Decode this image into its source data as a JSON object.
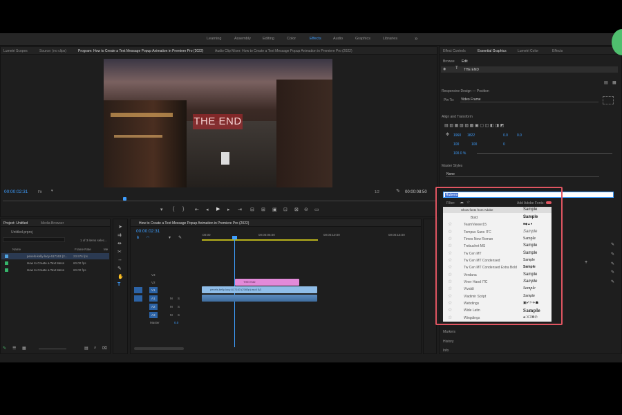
{
  "workspaces": {
    "tabs": [
      "Learning",
      "Assembly",
      "Editing",
      "Color",
      "Effects",
      "Audio",
      "Graphics",
      "Libraries"
    ],
    "active": "Effects",
    "more": "»"
  },
  "top_left_panel": {
    "tabs": [
      "Lumetri Scopes",
      "Source: (no clips)",
      "Program: How to Create a Text Message Popup Animation in Premiere Pro (2022)",
      "Audio Clip Mixer: How to Create a Text Message Popup Animation in Premiere Pro (2022)"
    ],
    "active_index": 2
  },
  "program": {
    "overlay_text": "THE END",
    "timecode_left": "00:00:02:31",
    "fit": "Fit",
    "fraction": "1/2",
    "timecode_right": "00:00:08:50"
  },
  "project": {
    "tabs": [
      "Project: Untitled",
      "Media Browser"
    ],
    "file": "Untitled.prproj",
    "selection": "1 of 3 items selec...",
    "columns": [
      "Name",
      "Frame Rate",
      "Me"
    ],
    "items": [
      {
        "name": "pexels-kelly-lacy-617163 (2...",
        "fps": "23.976 fps",
        "color": "#4fa3e0"
      },
      {
        "name": "How to Create a Text Mess",
        "fps": "60.00 fps",
        "color": "#36b46b"
      },
      {
        "name": "How to Create a Text Mess",
        "fps": "60.00 fps",
        "color": "#36b46b"
      }
    ]
  },
  "timeline": {
    "title": "How to Create a Text Message Popup Animation in Premiere Pro (2022)",
    "timecode": "00:00:02:31",
    "ruler": [
      ":00:00",
      "00:00:05:00",
      "00:00:10:00",
      "00:00:15:00"
    ],
    "tracks_v": [
      "V3",
      "V2",
      "V1"
    ],
    "tracks_a": [
      "A1",
      "A2",
      "A3"
    ],
    "master_label": "Master",
    "master_value": "0.0",
    "clip_text": "THE END",
    "clip_video": "pexels-kelly-lacy-617163 (2160p).mp4 [V]",
    "track_m": "M",
    "track_s": "S"
  },
  "right_panel": {
    "tabs": [
      "Effect Controls",
      "Essential Graphics",
      "Lumetri Color",
      "Effects"
    ],
    "active_index": 1,
    "subtabs": [
      "Browse",
      "Edit"
    ],
    "layer": "THE END",
    "responsive": "Responsive Design — Position",
    "pin_label": "Pin To:",
    "pin_value": "Video Frame",
    "align": "Align and Transform",
    "pos_x": "1960",
    "pos_y": "1822",
    "rot_a": "0.0",
    "rot_b": "0.0",
    "scale": "100",
    "scale2": "100",
    "anchor": "0",
    "opacity": "100.0 %",
    "master_styles": "Master Styles",
    "styles_value": "None",
    "font_search": "Rubens",
    "filter": "Filter:",
    "add_fonts": "Add Adobe Fonts:",
    "show_fonts": "Show fonts from Adobe",
    "header_sample": "Sample",
    "bottom_items": [
      "Markers",
      "History",
      "Info"
    ],
    "fonts": [
      {
        "name": "Bold",
        "sample": "Sample"
      },
      {
        "name": "TeamViewer15",
        "sample": "■◆▲●"
      },
      {
        "name": "Tempus Sans ITC",
        "sample": "Sample"
      },
      {
        "name": "Times New Roman",
        "sample": "Sample"
      },
      {
        "name": "Trebuchet MS",
        "sample": "Sample"
      },
      {
        "name": "Tw Cen MT",
        "sample": "Sample"
      },
      {
        "name": "Tw Cen MT Condensed",
        "sample": "Sample"
      },
      {
        "name": "Tw Cen MT Condensed Extra Bold",
        "sample": "Sample"
      },
      {
        "name": "Verdana",
        "sample": "Sample"
      },
      {
        "name": "Viner Hand ITC",
        "sample": "Sample"
      },
      {
        "name": "Vivaldi",
        "sample": "Sample"
      },
      {
        "name": "Vladimir Script",
        "sample": "Sample"
      },
      {
        "name": "Webdings",
        "sample": "▣✔︎⚐✈☗"
      },
      {
        "name": "Wide Latin",
        "sample": "Sample"
      },
      {
        "name": "Wingdings",
        "sample": "♦❍☐⌘✆"
      }
    ]
  },
  "colors": {
    "accent": "#3e9dfd",
    "highlight": "#e05561",
    "green": "#4fbf6e"
  }
}
